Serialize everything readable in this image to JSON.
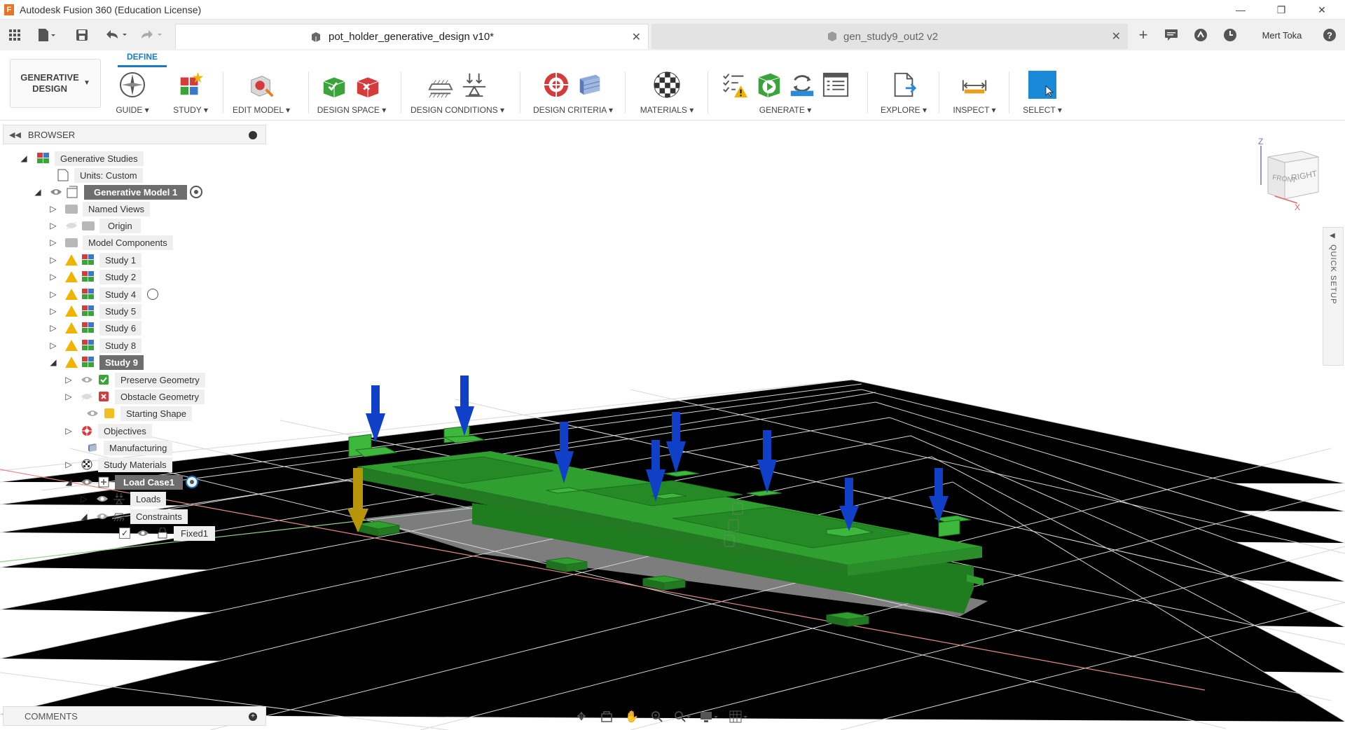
{
  "window": {
    "title": "Autodesk Fusion 360 (Education License)",
    "app_logo": "F",
    "controls": [
      "minimize-icon",
      "restore-icon",
      "close-icon"
    ]
  },
  "quick_access": {
    "user_name": "Mert Toka"
  },
  "tabs": [
    {
      "label": "pot_holder_generative_design v10*",
      "active": true
    },
    {
      "label": "gen_study9_out2 v2",
      "active": false
    }
  ],
  "toolbar": {
    "workspace": "GENERATIVE DESIGN",
    "active_tab": "DEFINE",
    "groups": [
      {
        "label": "GUIDE ▾"
      },
      {
        "label": "STUDY ▾"
      },
      {
        "label": "EDIT MODEL ▾"
      },
      {
        "label": "DESIGN SPACE ▾"
      },
      {
        "label": "DESIGN CONDITIONS ▾"
      },
      {
        "label": "DESIGN CRITERIA ▾"
      },
      {
        "label": "MATERIALS ▾"
      },
      {
        "label": "GENERATE ▾"
      },
      {
        "label": "EXPLORE ▾"
      },
      {
        "label": "INSPECT ▾"
      },
      {
        "label": "SELECT ▾"
      }
    ]
  },
  "browser": {
    "title": "BROWSER",
    "items": [
      {
        "label": "Generative Studies"
      },
      {
        "label": "Units: Custom"
      },
      {
        "label": "Generative Model 1"
      },
      {
        "label": "Named Views"
      },
      {
        "label": "Origin"
      },
      {
        "label": "Model Components"
      },
      {
        "label": "Study 1"
      },
      {
        "label": "Study 2"
      },
      {
        "label": "Study 4"
      },
      {
        "label": "Study 5"
      },
      {
        "label": "Study 6"
      },
      {
        "label": "Study 8"
      },
      {
        "label": "Study 9"
      },
      {
        "label": "Preserve Geometry"
      },
      {
        "label": "Obstacle Geometry"
      },
      {
        "label": "Starting Shape"
      },
      {
        "label": "Objectives"
      },
      {
        "label": "Manufacturing"
      },
      {
        "label": "Study Materials"
      },
      {
        "label": "Load Case1"
      },
      {
        "label": "Loads"
      },
      {
        "label": "Constraints"
      },
      {
        "label": "Fixed1"
      }
    ]
  },
  "comments": {
    "title": "COMMENTS"
  },
  "quick_setup": {
    "label": "QUICK SETUP"
  },
  "viewcube": {
    "front": "FRONT",
    "right": "RIGHT",
    "axis_z": "Z",
    "axis_x": "X"
  },
  "colors": {
    "model_green": "#2fa02f",
    "load_arrow_blue": "#1040c8",
    "constraint_arrow": "#b8940a",
    "select_blue": "#1a8ad8",
    "define_blue": "#1a7bc4"
  }
}
